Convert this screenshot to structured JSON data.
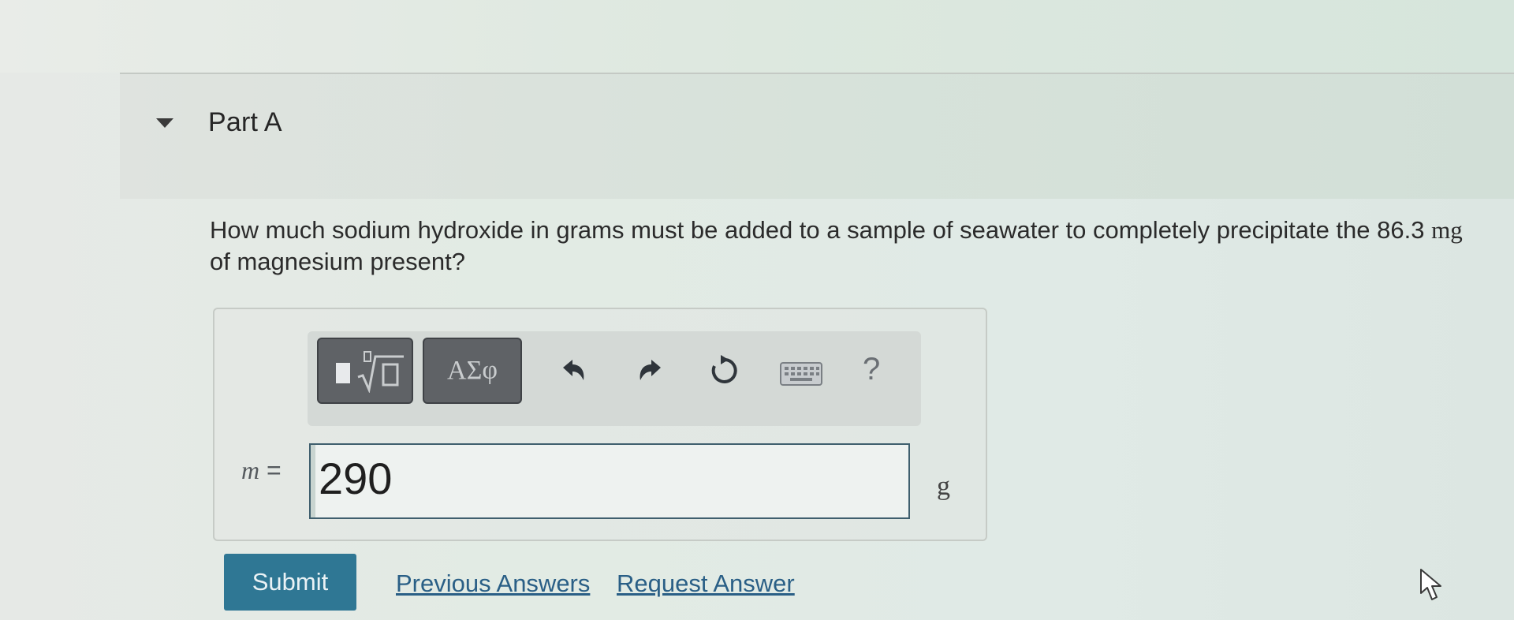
{
  "part": {
    "title": "Part A",
    "collapse_icon": "triangle-down-icon"
  },
  "question": {
    "text_before": "How much sodium hydroxide in grams must be added to a sample of seawater to completely precipitate the ",
    "amount": "86.3",
    "unit": "mg",
    "text_after": " of magnesium present?"
  },
  "toolbar": {
    "templates_icon": "templates-radical-icon",
    "symbols_label": "ΑΣφ",
    "undo_icon": "undo-icon",
    "redo_icon": "redo-icon",
    "reset_icon": "reset-icon",
    "keyboard_icon": "keyboard-icon",
    "help_label": "?"
  },
  "answer": {
    "variable": "m",
    "equals": " =",
    "value": "290",
    "unit": "g"
  },
  "actions": {
    "submit_label": "Submit",
    "previous_answers_label": "Previous Answers",
    "request_answer_label": "Request Answer"
  },
  "colors": {
    "submit_bg": "#2f7794",
    "link": "#2a5f86",
    "toolbar_button": "#5f6266"
  }
}
